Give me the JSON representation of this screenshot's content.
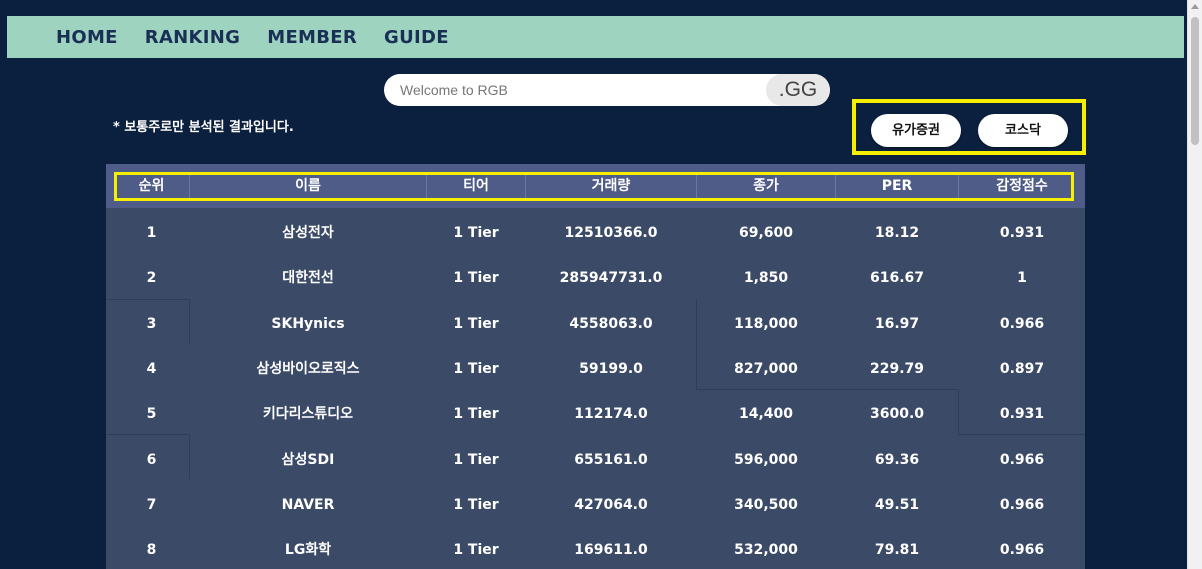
{
  "nav": {
    "items": [
      "HOME",
      "RANKING",
      "MEMBER",
      "GUIDE"
    ]
  },
  "search": {
    "placeholder": "Welcome to RGB",
    "suffix": ".GG"
  },
  "note": "* 보통주로만 분석된 결과입니다.",
  "markets": {
    "kospi": "유가증권",
    "kosdaq": "코스닥"
  },
  "table": {
    "headers": [
      "순위",
      "이름",
      "티어",
      "거래량",
      "종가",
      "PER",
      "감정점수"
    ],
    "rows": [
      [
        "1",
        "삼성전자",
        "1 Tier",
        "12510366.0",
        "69,600",
        "18.12",
        "0.931"
      ],
      [
        "2",
        "대한전선",
        "1 Tier",
        "285947731.0",
        "1,850",
        "616.67",
        "1"
      ],
      [
        "3",
        "SKHynics",
        "1 Tier",
        "4558063.0",
        "118,000",
        "16.97",
        "0.966"
      ],
      [
        "4",
        "삼성바이오로직스",
        "1 Tier",
        "59199.0",
        "827,000",
        "229.79",
        "0.897"
      ],
      [
        "5",
        "키다리스튜디오",
        "1 Tier",
        "112174.0",
        "14,400",
        "3600.0",
        "0.931"
      ],
      [
        "6",
        "삼성SDI",
        "1 Tier",
        "655161.0",
        "596,000",
        "69.36",
        "0.966"
      ],
      [
        "7",
        "NAVER",
        "1 Tier",
        "427064.0",
        "340,500",
        "49.51",
        "0.966"
      ],
      [
        "8",
        "LG화학",
        "1 Tier",
        "169611.0",
        "532,000",
        "79.81",
        "0.966"
      ]
    ]
  },
  "colors": {
    "background": "#0b1f3f",
    "nav": "#9ed3bf",
    "table_body": "#3b4a66",
    "table_header": "#4f5c87",
    "highlight": "#f6f000"
  }
}
